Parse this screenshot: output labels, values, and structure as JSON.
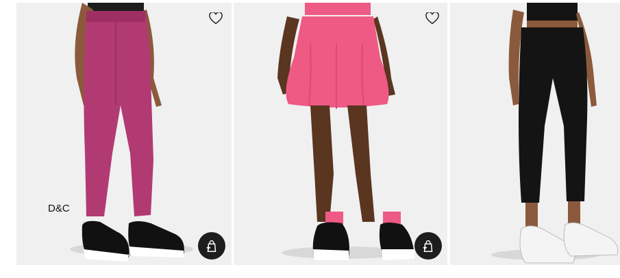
{
  "products": [
    {
      "card": "jogger-card",
      "color": "#b23a72",
      "fav_icon": "heart-outline-icon",
      "bag_icon": "quick-add-bag-icon"
    },
    {
      "card": "skort-card",
      "color": "#ee5a84",
      "fav_icon": "heart-outline-icon",
      "bag_icon": "quick-add-bag-icon"
    },
    {
      "card": "legging-card",
      "color": "#141414",
      "fav_icon": "heart-outline-icon"
    }
  ],
  "watermark": {
    "text": "D&C"
  }
}
